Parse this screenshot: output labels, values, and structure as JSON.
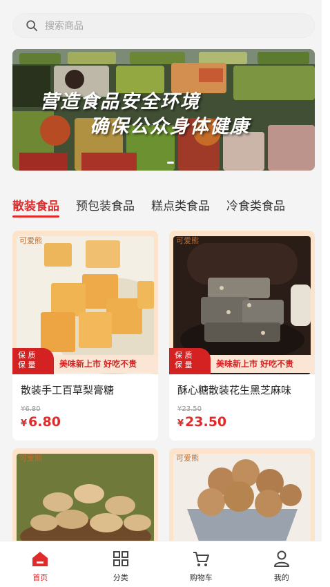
{
  "search": {
    "placeholder": "搜索商品"
  },
  "banner": {
    "line1": "营造食品安全环境",
    "line2": "确保公众身体健康"
  },
  "tabs": [
    {
      "label": "散装食品",
      "active": true
    },
    {
      "label": "预包装食品",
      "active": false
    },
    {
      "label": "糕点类食品",
      "active": false
    },
    {
      "label": "冷食类食品",
      "active": false
    }
  ],
  "products": [
    {
      "brand": "可爱熊",
      "badge_line1": "保 质",
      "badge_line2": "保 量",
      "slogan": "美味新上市 好吃不贵",
      "title": "散装手工百草梨膏糖",
      "old_price": "¥6.80",
      "currency": "¥",
      "price": "6.80"
    },
    {
      "brand": "可爱熊",
      "badge_line1": "保 质",
      "badge_line2": "保 量",
      "slogan": "美味新上市 好吃不贵",
      "title": "酥心糖散装花生黑芝麻味",
      "old_price": "¥23.50",
      "currency": "¥",
      "price": "23.50"
    },
    {
      "brand": "可爱熊"
    },
    {
      "brand": "可爱熊"
    }
  ],
  "tabbar": [
    {
      "label": "首页",
      "icon": "home-icon",
      "active": true
    },
    {
      "label": "分类",
      "icon": "grid-icon",
      "active": false
    },
    {
      "label": "购物车",
      "icon": "cart-icon",
      "active": false
    },
    {
      "label": "我的",
      "icon": "user-icon",
      "active": false
    }
  ],
  "colors": {
    "accent": "#e02b2b",
    "ribbon": "#d42121",
    "card_frame": "#fde3c9"
  }
}
